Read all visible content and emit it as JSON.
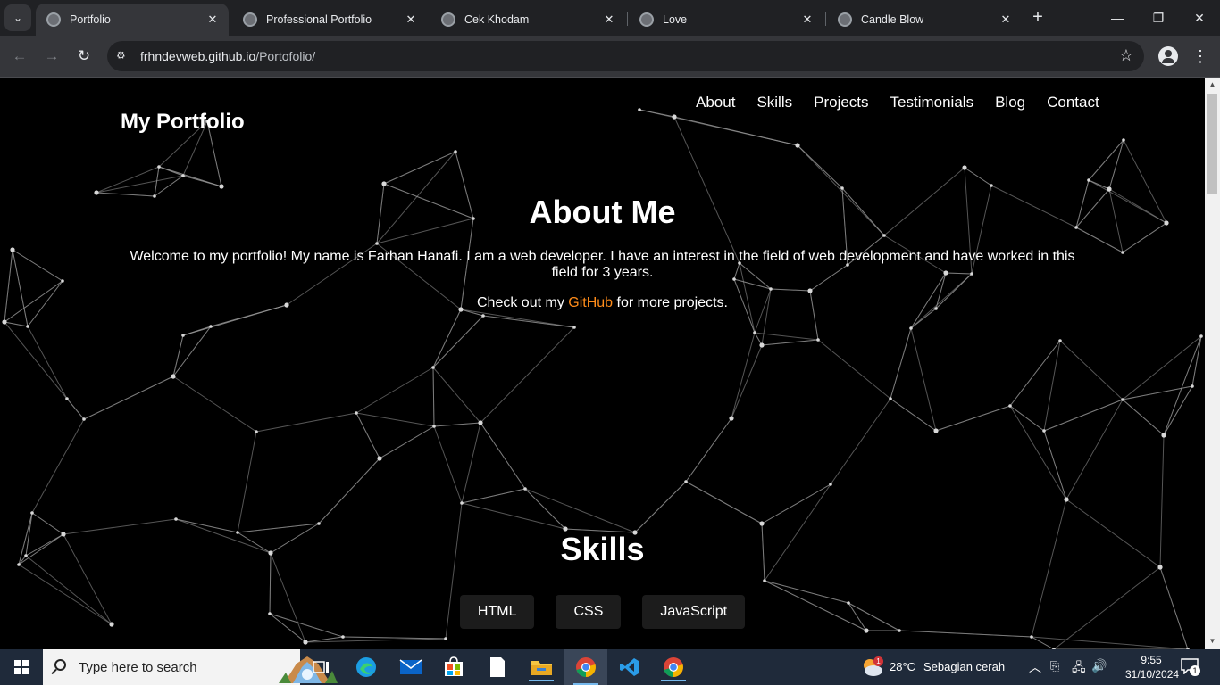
{
  "browser": {
    "tabs": [
      {
        "title": "Portfolio",
        "active": true
      },
      {
        "title": "Professional Portfolio",
        "active": false
      },
      {
        "title": "Cek Khodam",
        "active": false
      },
      {
        "title": "Love",
        "active": false
      },
      {
        "title": "Candle Blow",
        "active": false
      }
    ],
    "close_glyph": "✕",
    "new_tab_glyph": "+",
    "url_host": "frhndevweb.github.io",
    "url_path": "/Portofolio/",
    "window_controls": {
      "minimize": "—",
      "restore": "❐",
      "close": "✕"
    }
  },
  "page": {
    "site_title": "My Portfolio",
    "nav": [
      "About",
      "Skills",
      "Projects",
      "Testimonials",
      "Blog",
      "Contact"
    ],
    "about": {
      "heading": "About Me",
      "text": "Welcome to my portfolio! My name is Farhan Hanafi. I am a web developer. I have an interest in the field of web development and have worked in this field for 3 years.",
      "more_prefix": "Check out my ",
      "more_link": "GitHub",
      "more_suffix": " for more projects."
    },
    "skills": {
      "heading": "Skills",
      "items": [
        "HTML",
        "CSS",
        "JavaScript"
      ]
    },
    "link_color": "#ff8c1a"
  },
  "taskbar": {
    "search_placeholder": "Type here to search",
    "weather_temp": "28°C",
    "weather_desc": "Sebagian cerah",
    "weather_badge": "1",
    "time": "9:55",
    "date": "31/10/2024",
    "notification_count": "1",
    "apps": [
      "task-view-icon",
      "edge-icon",
      "mail-icon",
      "store-icon",
      "notepad-icon",
      "file-explorer-icon",
      "chrome-icon",
      "vscode-icon",
      "chrome-icon"
    ]
  }
}
